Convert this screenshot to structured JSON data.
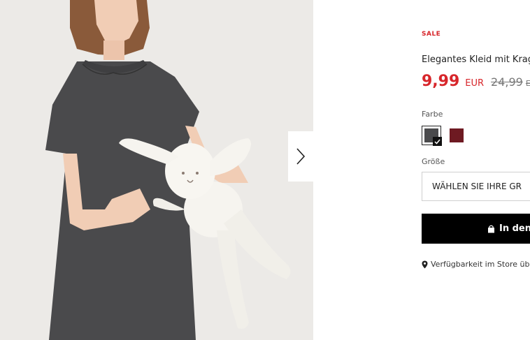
{
  "product": {
    "badge": "SALE",
    "name": "Elegantes Kleid mit Krag",
    "price_current": "9,99",
    "price_currency": "EUR",
    "price_old": "24,99",
    "price_old_currency": "EU",
    "color_label": "Farbe",
    "colors": [
      {
        "name": "dark-grey",
        "hex": "#4a4a4c",
        "selected": true
      },
      {
        "name": "burgundy",
        "hex": "#6e1a22",
        "selected": false
      }
    ],
    "size_label": "Größe",
    "size_select_placeholder": "WÄHLEN SIE IHRE GR",
    "add_to_cart_label": "In den",
    "store_availability_label": "Verfügbarkeit im Store üb"
  },
  "gallery": {
    "next_icon": "chevron-right-icon"
  },
  "colors": {
    "sale_red": "#d7262b",
    "button_black": "#000000"
  }
}
